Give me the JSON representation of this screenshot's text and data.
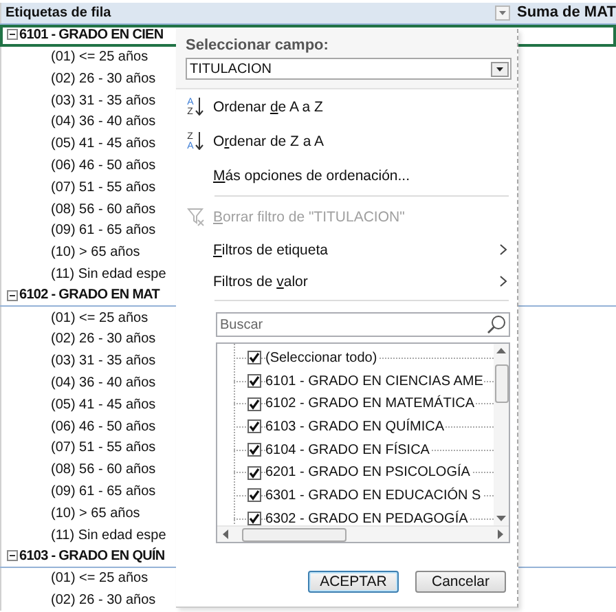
{
  "pivot": {
    "row_labels_header": "Etiquetas de fila",
    "value_header": "Suma de MAT",
    "groups": [
      {
        "label": "6101 - GRADO EN CIEN",
        "expanded": true,
        "selected": true,
        "items": [
          "(01) <= 25 años",
          "(02) 26 - 30 años",
          "(03) 31 - 35 años",
          "(04) 36 - 40 años",
          "(05) 41 - 45 años",
          "(06) 46 - 50 años",
          "(07) 51 - 55 años",
          "(08) 56 - 60 años",
          "(09) 61 - 65 años",
          "(10) > 65 años",
          "(11) Sin edad espe"
        ]
      },
      {
        "label": "6102 - GRADO EN MAT",
        "expanded": true,
        "selected": false,
        "items": [
          "(01) <= 25 años",
          "(02) 26 - 30 años",
          "(03) 31 - 35 años",
          "(04) 36 - 40 años",
          "(05) 41 - 45 años",
          "(06) 46 - 50 años",
          "(07) 51 - 55 años",
          "(08) 56 - 60 años",
          "(09) 61 - 65 años",
          "(10) > 65 años",
          "(11) Sin edad espe"
        ]
      },
      {
        "label": "6103 - GRADO EN QUÍN",
        "expanded": true,
        "selected": false,
        "items": [
          "(01) <= 25 años",
          "(02) 26 - 30 años"
        ]
      }
    ]
  },
  "filter_menu": {
    "field_label": "Seleccionar campo:",
    "field_value": "TITULACION",
    "items": [
      {
        "kind": "sort_asc",
        "icon_letters": [
          "A",
          "Z"
        ],
        "text_before": "Ordenar ",
        "access_key": "d",
        "text_after": "e A a Z",
        "disabled": false
      },
      {
        "kind": "sort_desc",
        "icon_letters": [
          "Z",
          "A"
        ],
        "text_before": "O",
        "access_key": "r",
        "text_after": "denar de Z a A",
        "disabled": false
      },
      {
        "kind": "option",
        "access_key": "M",
        "text_after": "ás opciones de ordenación...",
        "disabled": false
      },
      {
        "kind": "clear_filter",
        "access_key": "B",
        "text_after": "orrar filtro de \"TITULACION\"",
        "disabled": true
      },
      {
        "kind": "submenu",
        "access_key": "F",
        "text_after": "iltros de etiqueta",
        "disabled": false
      },
      {
        "kind": "submenu",
        "text_before": "Filtros de ",
        "access_key": "v",
        "text_after": "alor",
        "disabled": false
      }
    ],
    "search": {
      "placeholder": "Buscar"
    },
    "values": [
      {
        "label": "(Seleccionar todo)",
        "checked": true
      },
      {
        "label": "6101 - GRADO EN CIENCIAS AME",
        "checked": true
      },
      {
        "label": "6102 - GRADO EN MATEMÁTICA",
        "checked": true
      },
      {
        "label": "6103 - GRADO EN QUÍMICA",
        "checked": true
      },
      {
        "label": "6104 - GRADO EN FÍSICA",
        "checked": true
      },
      {
        "label": "6201 - GRADO EN PSICOLOGÍA",
        "checked": true
      },
      {
        "label": "6301 - GRADO EN EDUCACIÓN S",
        "checked": true
      },
      {
        "label": "6302 - GRADO EN PEDAGOGÍA",
        "checked": true
      }
    ],
    "buttons": [
      {
        "label": "ACEPTAR",
        "selected": true
      },
      {
        "label": "Cancelar",
        "selected": false
      }
    ]
  }
}
